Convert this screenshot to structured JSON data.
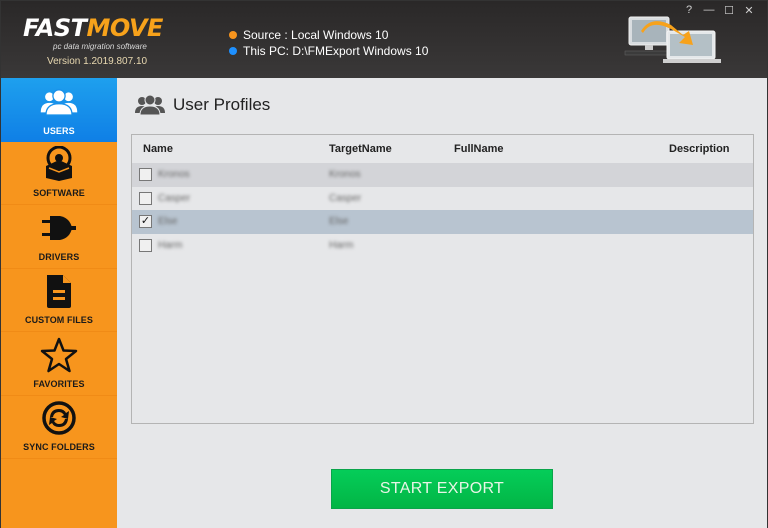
{
  "app": {
    "logo_part1": "FAST",
    "logo_part2": "MOVE",
    "tagline": "pc data migration software",
    "version": "Version 1.2019.807.10"
  },
  "status": {
    "source": {
      "label": "Source : Local Windows 10",
      "color": "#f7941d"
    },
    "target": {
      "label": "This PC: D:\\FMExport Windows 10",
      "color": "#1e90ff"
    }
  },
  "window_controls": {
    "help": "?",
    "minimize": "—",
    "maximize": "☐",
    "close": "✕"
  },
  "sidebar": {
    "items": [
      {
        "label": "USERS",
        "icon": "users-icon",
        "active": true
      },
      {
        "label": "SOFTWARE",
        "icon": "software-icon",
        "active": false
      },
      {
        "label": "DRIVERS",
        "icon": "plug-icon",
        "active": false
      },
      {
        "label": "CUSTOM FILES",
        "icon": "file-icon",
        "active": false
      },
      {
        "label": "FAVORITES",
        "icon": "star-icon",
        "active": false
      },
      {
        "label": "SYNC FOLDERS",
        "icon": "sync-icon",
        "active": false
      }
    ]
  },
  "main": {
    "title": "User Profiles",
    "table": {
      "columns": [
        "Name",
        "TargetName",
        "FullName",
        "Description"
      ],
      "rows": [
        {
          "checked": false,
          "name": "Kronos",
          "target": "Kronos",
          "fullname": "",
          "description": ""
        },
        {
          "checked": false,
          "name": "Casper",
          "target": "Casper",
          "fullname": "",
          "description": ""
        },
        {
          "checked": true,
          "name": "Else",
          "target": "Else",
          "fullname": "",
          "description": ""
        },
        {
          "checked": false,
          "name": "Harm",
          "target": "Harm",
          "fullname": "",
          "description": ""
        }
      ]
    },
    "start_button": "START EXPORT"
  },
  "colors": {
    "accent_orange": "#f7951d",
    "active_blue": "#1590ea",
    "button_green": "#02c150",
    "header_dark": "#2f2d2d"
  }
}
